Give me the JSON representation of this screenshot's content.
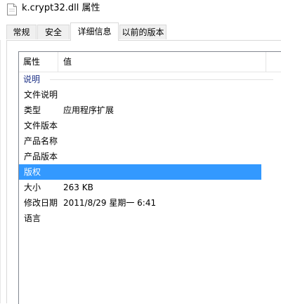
{
  "window": {
    "title": "k.crypt32.dll 属性"
  },
  "tabs": [
    {
      "label": "常规",
      "active": false
    },
    {
      "label": "安全",
      "active": false
    },
    {
      "label": "详细信息",
      "active": true
    },
    {
      "label": "以前的版本",
      "active": false
    }
  ],
  "details": {
    "header": {
      "property": "属性",
      "value": "值"
    },
    "group_label": "说明",
    "rows": [
      {
        "name": "文件说明",
        "value": ""
      },
      {
        "name": "类型",
        "value": "应用程序扩展"
      },
      {
        "name": "文件版本",
        "value": ""
      },
      {
        "name": "产品名称",
        "value": ""
      },
      {
        "name": "产品版本",
        "value": ""
      },
      {
        "name": "版权",
        "value": "",
        "selected": true
      },
      {
        "name": "大小",
        "value": "263 KB"
      },
      {
        "name": "修改日期",
        "value": "2011/8/29 星期一 6:41"
      },
      {
        "name": "语言",
        "value": ""
      }
    ]
  },
  "colors": {
    "selection": "#3399ff",
    "group_label": "#1e3287"
  },
  "icons": {
    "title": "document-icon"
  }
}
